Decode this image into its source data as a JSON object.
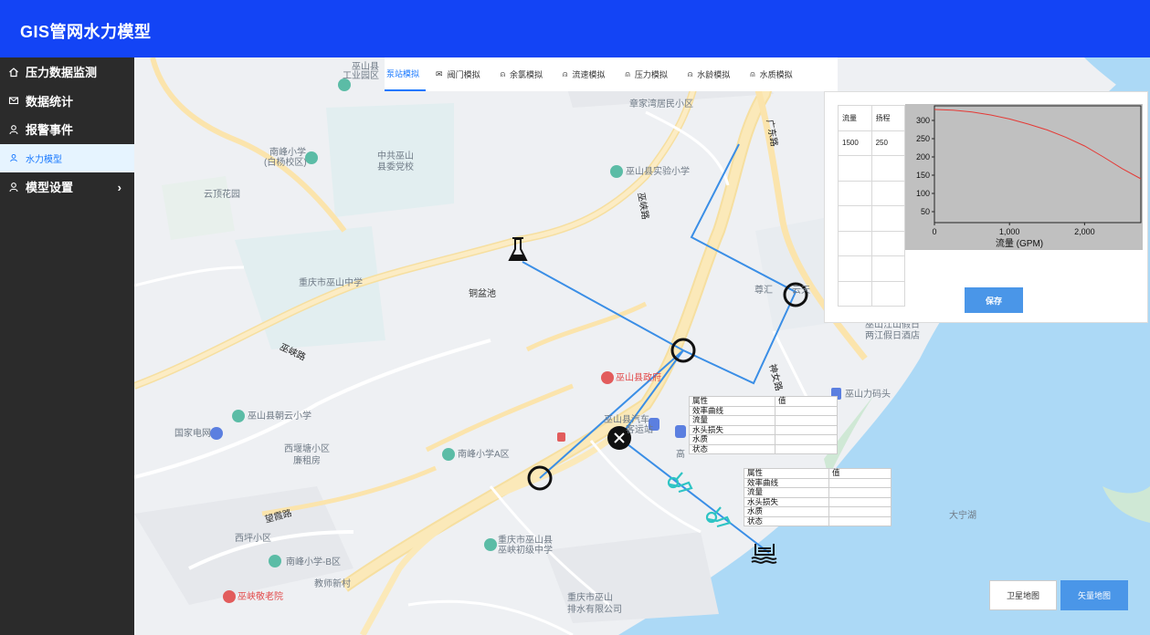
{
  "header": {
    "title": "GIS管网水力模型"
  },
  "sidebar": {
    "items": [
      {
        "label": "压力数据监测",
        "icon": "home-icon"
      },
      {
        "label": "数据统计",
        "icon": "mail-icon"
      },
      {
        "label": "报警事件",
        "icon": "user-icon"
      },
      {
        "label": "水力模型",
        "icon": "user-icon",
        "active": true
      },
      {
        "label": "模型设置",
        "icon": "user-icon",
        "chevron": "›"
      }
    ]
  },
  "tabs": [
    {
      "label": "泵站模拟",
      "icon": "pump-icon",
      "active": true
    },
    {
      "label": "阀门模拟",
      "icon": "mail-icon"
    },
    {
      "label": "余氯模拟",
      "icon": "user-icon"
    },
    {
      "label": "流速模拟",
      "icon": "user-icon"
    },
    {
      "label": "压力模拟",
      "icon": "user-icon"
    },
    {
      "label": "水龄模拟",
      "icon": "user-icon"
    },
    {
      "label": "水质模拟",
      "icon": "user-icon"
    }
  ],
  "pump_panel": {
    "headers": [
      "流量",
      "扬程"
    ],
    "rows": [
      [
        "1500",
        "250"
      ],
      [
        "",
        ""
      ],
      [
        "",
        ""
      ],
      [
        "",
        ""
      ],
      [
        "",
        ""
      ],
      [
        "",
        ""
      ],
      [
        "",
        ""
      ]
    ],
    "save_label": "保存"
  },
  "chart_data": {
    "type": "line",
    "title": "",
    "xlabel": "流量 (GPM)",
    "ylabel": "",
    "xlim": [
      0,
      2750
    ],
    "ylim": [
      20,
      340
    ],
    "xticks": [
      "0",
      "1,000",
      "2,000"
    ],
    "yticks": [
      "50",
      "100",
      "150",
      "200",
      "250",
      "300"
    ],
    "x": [
      0,
      250,
      500,
      750,
      1000,
      1250,
      1500,
      1750,
      2000,
      2250,
      2500,
      2750
    ],
    "y": [
      330,
      328,
      323,
      315,
      304,
      290,
      274,
      254,
      230,
      200,
      168,
      140
    ],
    "color": "#e53935",
    "background": "#c0c0c0"
  },
  "info_table_1": {
    "rows": [
      [
        "属性",
        "值"
      ],
      [
        "效率曲线",
        ""
      ],
      [
        "流量",
        ""
      ],
      [
        "水头损失",
        ""
      ],
      [
        "水质",
        ""
      ],
      [
        "状态",
        ""
      ]
    ]
  },
  "info_table_2": {
    "rows": [
      [
        "属性",
        "值"
      ],
      [
        "效率曲线",
        ""
      ],
      [
        "流量",
        ""
      ],
      [
        "水头损失",
        ""
      ],
      [
        "水质",
        ""
      ],
      [
        "状态",
        ""
      ]
    ]
  },
  "map_buttons": {
    "satellite": "卫星地图",
    "vector": "矢量地图"
  },
  "map_labels": [
    "巫山县",
    "工业园区",
    "章家湾居民小区",
    "广东路",
    "南峰小学",
    "(白杨校区)",
    "中共巫山",
    "县委党校",
    "巫山县实验小学",
    "巫峡路",
    "云顶花园",
    "重庆市巫山中学",
    "铜盆池",
    "尊汇",
    "云天",
    "巫山江山假日",
    "两江假日酒店",
    "巫峡路",
    "巫山县政府",
    "巫山力码头",
    "巫山县朝云小学",
    "国家电网",
    "巫山县汽车",
    "客运站",
    "西堰塘小区",
    "廉租房",
    "南峰小学A区",
    "高",
    "望霞路",
    "西坪小区",
    "重庆市巫山县",
    "巫峡初级中学",
    "南峰小学-B区",
    "教师新村",
    "重庆市巫山",
    "排水有限公司",
    "巫峡敬老院",
    "大宁湖",
    "神女路"
  ],
  "colors": {
    "header": "#1344f5",
    "sidebar": "#2b2b2b",
    "accent": "#1677ff",
    "pipe": "#3a8ee6",
    "water": "#acd9f6",
    "road": "#fbe3a3"
  }
}
